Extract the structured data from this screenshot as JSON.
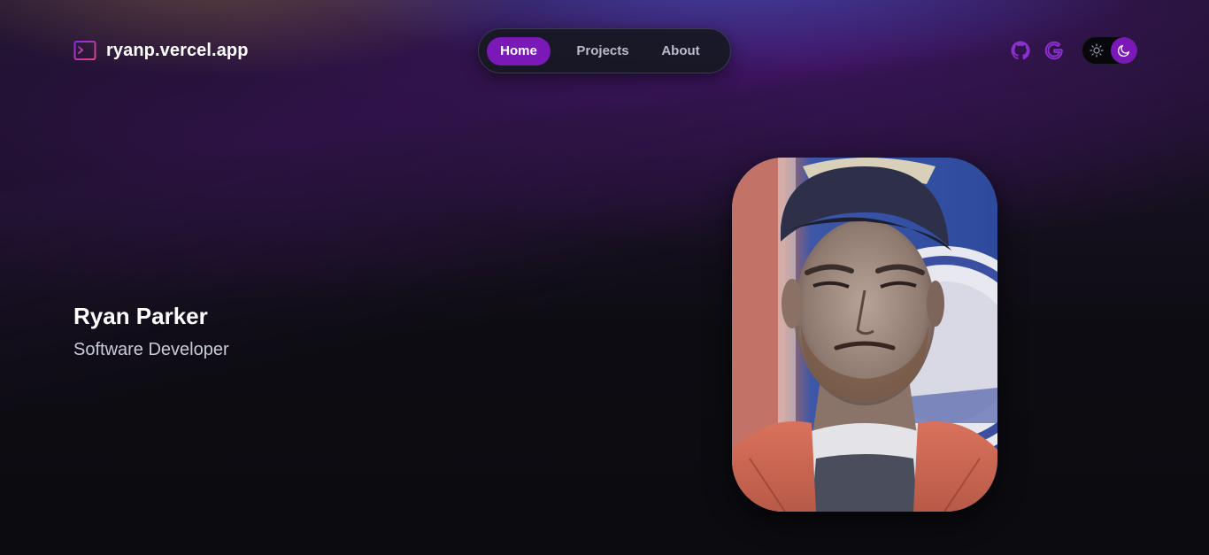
{
  "brand": {
    "title": "ryanp.vercel.app",
    "icon": "terminal-icon"
  },
  "nav": {
    "items": [
      {
        "label": "Home",
        "active": true
      },
      {
        "label": "Projects",
        "active": false
      },
      {
        "label": "About",
        "active": false
      }
    ]
  },
  "header_icons": {
    "github": "github-icon",
    "google": "google-icon",
    "theme_toggle": {
      "light": "sun-icon",
      "dark": "moon-icon",
      "selected": "dark"
    }
  },
  "hero": {
    "name": "Ryan Parker",
    "role": "Software Developer"
  },
  "colors": {
    "accent": "#7a18b8",
    "background": "#0c0b11",
    "nav_background": "#161822",
    "muted_text": "#b9bccb"
  }
}
